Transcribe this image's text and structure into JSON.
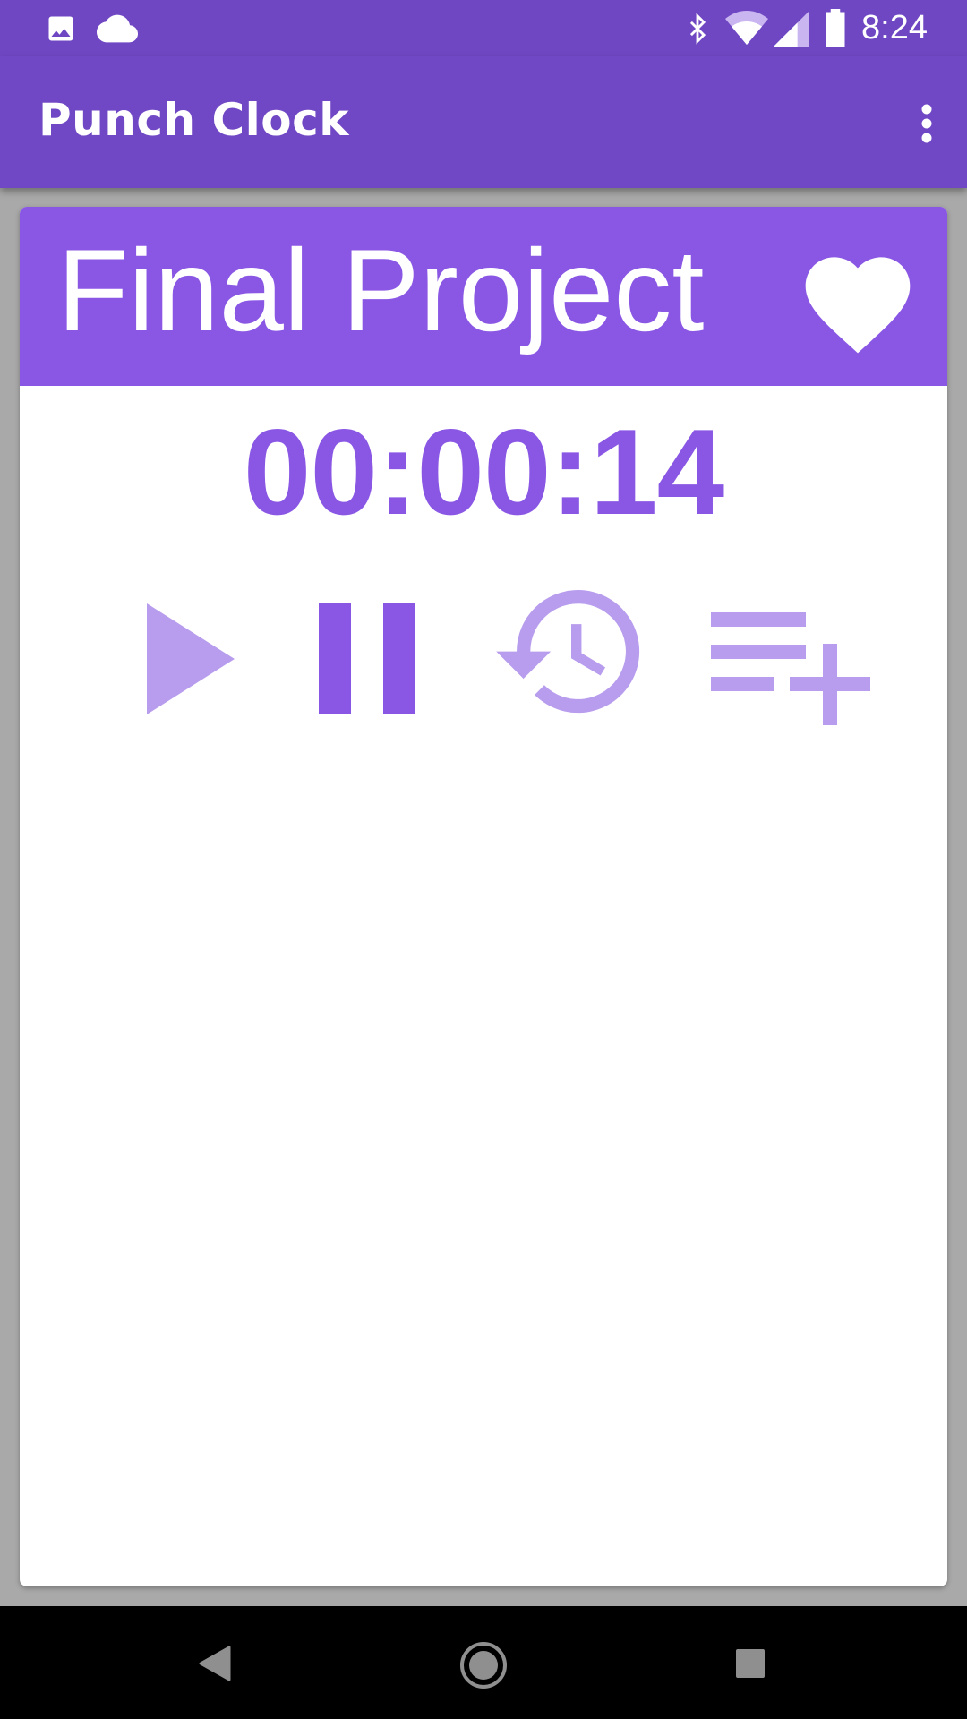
{
  "status_bar": {
    "time": "8:24",
    "icons": [
      "image-icon",
      "cloud-icon",
      "bluetooth-icon",
      "wifi-icon",
      "signal-icon",
      "battery-icon"
    ]
  },
  "app_bar": {
    "title": "Punch Clock",
    "menu_icon": "more-vert-icon"
  },
  "project_card": {
    "title": "Final Project",
    "favorite_icon": "heart-icon",
    "elapsed": "00:00:14",
    "controls": [
      "play-icon",
      "pause-icon",
      "history-icon",
      "playlist-add-icon"
    ]
  },
  "nav_bar": {
    "icons": [
      "back-icon",
      "home-icon",
      "recents-icon"
    ]
  },
  "colors": {
    "status_bar": "#6f47c3",
    "app_bar": "#7047c4",
    "accent": "#8a57e5",
    "accent_light": "#b89cee",
    "card_bg": "#ffffff",
    "screen_bg": "#a9a9a9",
    "nav_bar": "#000000"
  }
}
